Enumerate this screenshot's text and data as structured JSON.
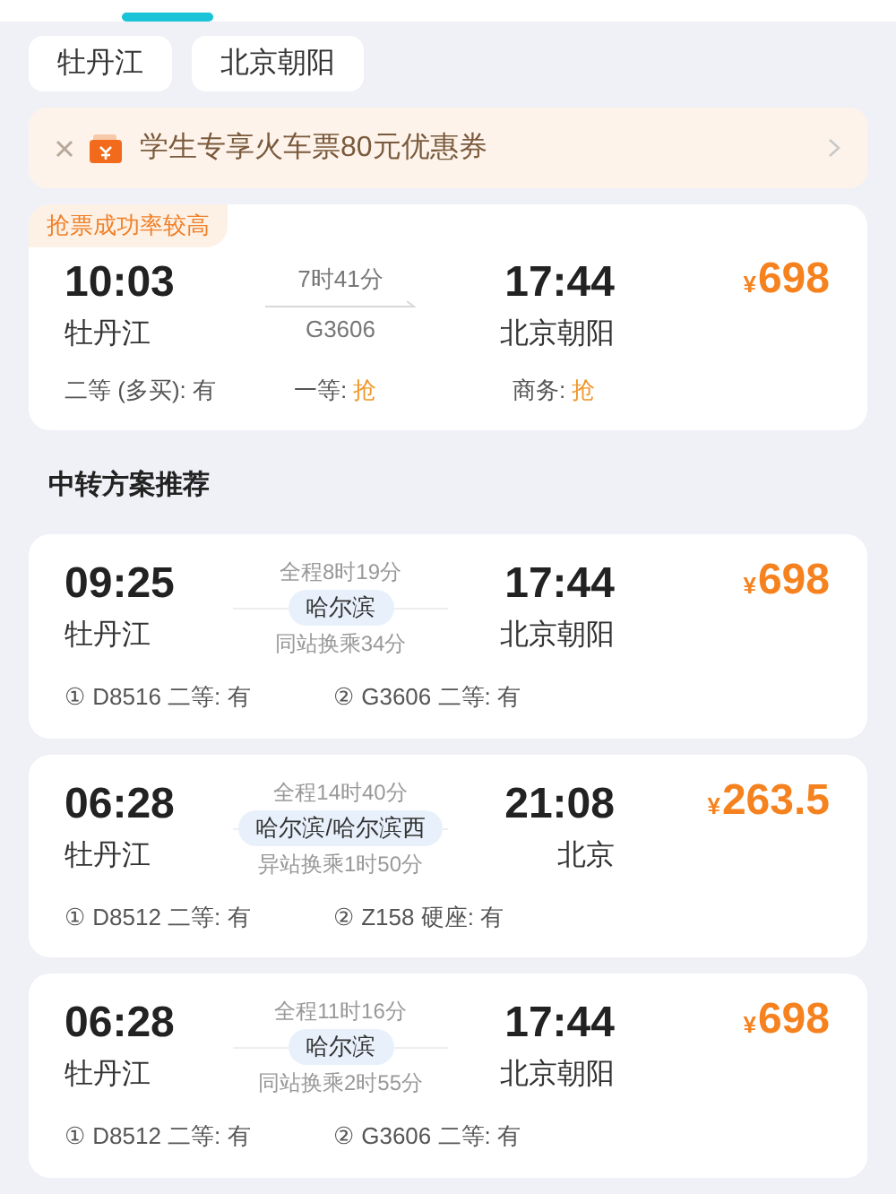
{
  "route_chips": [
    "牡丹江",
    "北京朝阳"
  ],
  "promo_banner": {
    "text": "学生专享火车票80元优惠券"
  },
  "direct_train": {
    "tag": "抢票成功率较高",
    "depart_time": "10:03",
    "depart_station": "牡丹江",
    "duration": "7时41分",
    "train_no": "G3606",
    "arrive_time": "17:44",
    "arrive_station": "北京朝阳",
    "currency": "¥",
    "price": "698",
    "seats": [
      {
        "label": "二等 (多买):",
        "value": "有",
        "kind": "available"
      },
      {
        "label": "一等:",
        "value": "抢",
        "kind": "grab"
      },
      {
        "label": "商务:",
        "value": "抢",
        "kind": "grab"
      }
    ]
  },
  "transfer_heading": "中转方案推荐",
  "transfer_plans": [
    {
      "depart_time": "09:25",
      "depart_station": "牡丹江",
      "total": "全程8时19分",
      "via": "哈尔滨",
      "transfer_note": "同站换乘34分",
      "arrive_time": "17:44",
      "arrive_station": "北京朝阳",
      "currency": "¥",
      "price": "698",
      "legs": [
        {
          "num": "①",
          "train": "D8516",
          "seat": "二等: 有"
        },
        {
          "num": "②",
          "train": "G3606",
          "seat": "二等: 有"
        }
      ]
    },
    {
      "depart_time": "06:28",
      "depart_station": "牡丹江",
      "total": "全程14时40分",
      "via": "哈尔滨/哈尔滨西",
      "transfer_note": "异站换乘1时50分",
      "arrive_time": "21:08",
      "arrive_station": "北京",
      "currency": "¥",
      "price": "263.5",
      "legs": [
        {
          "num": "①",
          "train": "D8512",
          "seat": "二等: 有"
        },
        {
          "num": "②",
          "train": "Z158",
          "seat": "硬座: 有"
        }
      ]
    },
    {
      "depart_time": "06:28",
      "depart_station": "牡丹江",
      "total": "全程11时16分",
      "via": "哈尔滨",
      "transfer_note": "同站换乘2时55分",
      "arrive_time": "17:44",
      "arrive_station": "北京朝阳",
      "currency": "¥",
      "price": "698",
      "legs": [
        {
          "num": "①",
          "train": "D8512",
          "seat": "二等: 有"
        },
        {
          "num": "②",
          "train": "G3606",
          "seat": "二等: 有"
        }
      ]
    }
  ]
}
